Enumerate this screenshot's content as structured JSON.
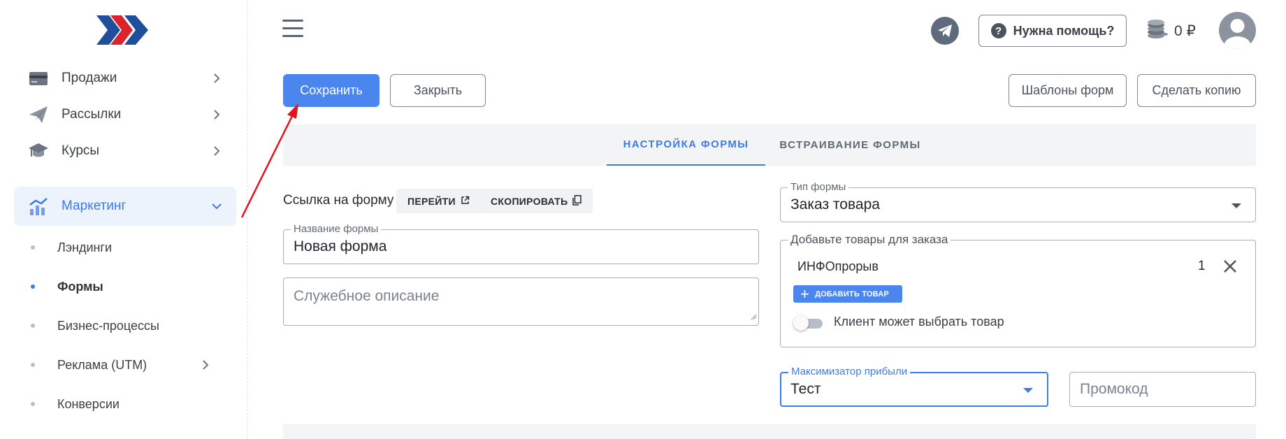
{
  "sidebar": {
    "items": [
      {
        "label": "Продажи",
        "icon": "card-icon"
      },
      {
        "label": "Рассылки",
        "icon": "paper-plane-icon"
      },
      {
        "label": "Курсы",
        "icon": "graduation-cap-icon"
      },
      {
        "label": "Маркетинг",
        "icon": "chart-icon",
        "active": true
      }
    ],
    "subitems": [
      {
        "label": "Лэндинги"
      },
      {
        "label": "Формы",
        "active": true
      },
      {
        "label": "Бизнес-процессы"
      },
      {
        "label": "Реклама (UTM)"
      },
      {
        "label": "Конверсии"
      }
    ]
  },
  "header": {
    "help_label": "Нужна помощь?",
    "balance": "0 ₽"
  },
  "toolbar": {
    "save_label": "Сохранить",
    "close_label": "Закрыть",
    "templates_label": "Шаблоны форм",
    "copy_label": "Сделать копию"
  },
  "tabs": [
    {
      "label": "НАСТРОЙКА ФОРМЫ",
      "active": true
    },
    {
      "label": "ВСТРАИВАНИЕ ФОРМЫ"
    }
  ],
  "form": {
    "link_label": "Ссылка на форму",
    "goto_label": "ПЕРЕЙТИ",
    "copy_link_label": "СКОПИРОВАТЬ",
    "name_legend": "Название формы",
    "name_value": "Новая форма",
    "description_placeholder": "Служебное описание",
    "type_legend": "Тип формы",
    "type_value": "Заказ товара",
    "products_legend": "Добавьте товары для заказа",
    "products": [
      {
        "name": "ИНФОпрорыв",
        "qty": "1"
      }
    ],
    "add_product_label": "ДОБАВИТЬ ТОВАР",
    "client_choose_label": "Клиент может выбрать товар",
    "client_choose_on": false,
    "maximizer_legend": "Максимизатор прибыли",
    "maximizer_value": "Тест",
    "promo_placeholder": "Промокод"
  },
  "colors": {
    "accent": "#4a86ee",
    "active_text": "#3c7be8",
    "annotation_arrow": "#e3121b"
  }
}
